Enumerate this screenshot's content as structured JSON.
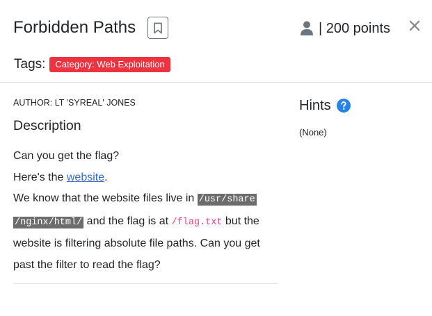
{
  "challenge": {
    "title": "Forbidden Paths",
    "points": "| 200 points"
  },
  "tags": {
    "label": "Tags:",
    "items": [
      {
        "label": "Category: Web Exploitation",
        "color": "#ee3340"
      }
    ]
  },
  "content": {
    "author": "AUTHOR: LT 'SYREAL' JONES",
    "description_title": "Description",
    "line1": "Can you get the flag?",
    "line2_prefix": "Here's the ",
    "line2_link": "website",
    "line2_suffix": ".",
    "line3_prefix": "We know that the website files live in ",
    "path_part1": "/usr/share",
    "path_part2": "/nginx/html/",
    "line4_mid": " and the flag is at ",
    "flag_path": "/flag.txt",
    "line4_end": " but the",
    "line5": "website is filtering absolute file paths. Can you get",
    "line6": "past the filter to read the flag?"
  },
  "hints": {
    "title": "Hints",
    "none_text": "(None)"
  },
  "icons": {
    "bookmark": "bookmark-icon",
    "user": "user-icon",
    "close": "close-icon",
    "help": "question-circle-icon"
  },
  "colors": {
    "tag_red": "#ee3340",
    "link_blue": "#3c6bc4",
    "help_blue": "#2684e6",
    "code_bg": "#6c6c6c",
    "flag_pink": "#e83e8c"
  }
}
